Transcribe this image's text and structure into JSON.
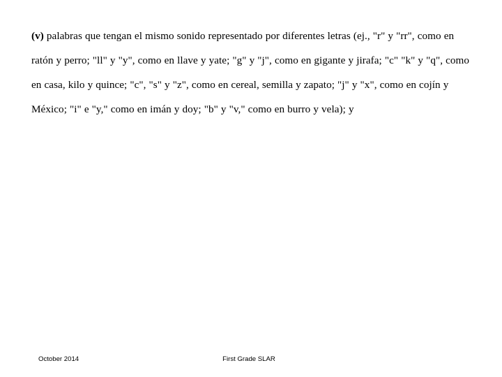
{
  "slide": {
    "background_color": "#ffffff",
    "text_color": "#000000",
    "body": {
      "lead_marker": "(v)",
      "paragraph": " palabras que tengan el mismo sonido representado por diferentes letras (ej., \"r\" y \"rr\", como en ratón y perro; \"ll\" y \"y\", como en llave y yate; \"g\" y \"j\", como en gigante y jirafa; \"c\" \"k\" y \"q\", como en casa, kilo y quince; \"c\", \"s\" y \"z\", como en cereal, semilla y zapato; \"j\" y \"x\", como en cojín y México; \"i\" e \"y,\" como en imán y doy; \"b\" y \"v,\" como en burro y vela); y",
      "rendered_lines": [
        "(v) palabras que tengan el mismo sonido representado por diferentes letras (ej.,",
        "\"r\" y \"rr\", como en ratón y perro; \"ll\" y \"y\", como en llave y yate; \"g\" y \"j\", como en",
        "gigante y jirafa; \"c\" \"k\" y \"q\", como en casa, kilo y quince; \"c\", \"s\" y \"z\", como en",
        "cereal, semilla y zapato; \"j\" y \"x\", como en cojín y México; \"i\" e \"y,\" como en imán y",
        "doy; \"b\" y \"v,\" como en burro y vela); y"
      ]
    },
    "footer": {
      "date": "October 2014",
      "center": "First Grade SLAR",
      "right": ""
    }
  }
}
